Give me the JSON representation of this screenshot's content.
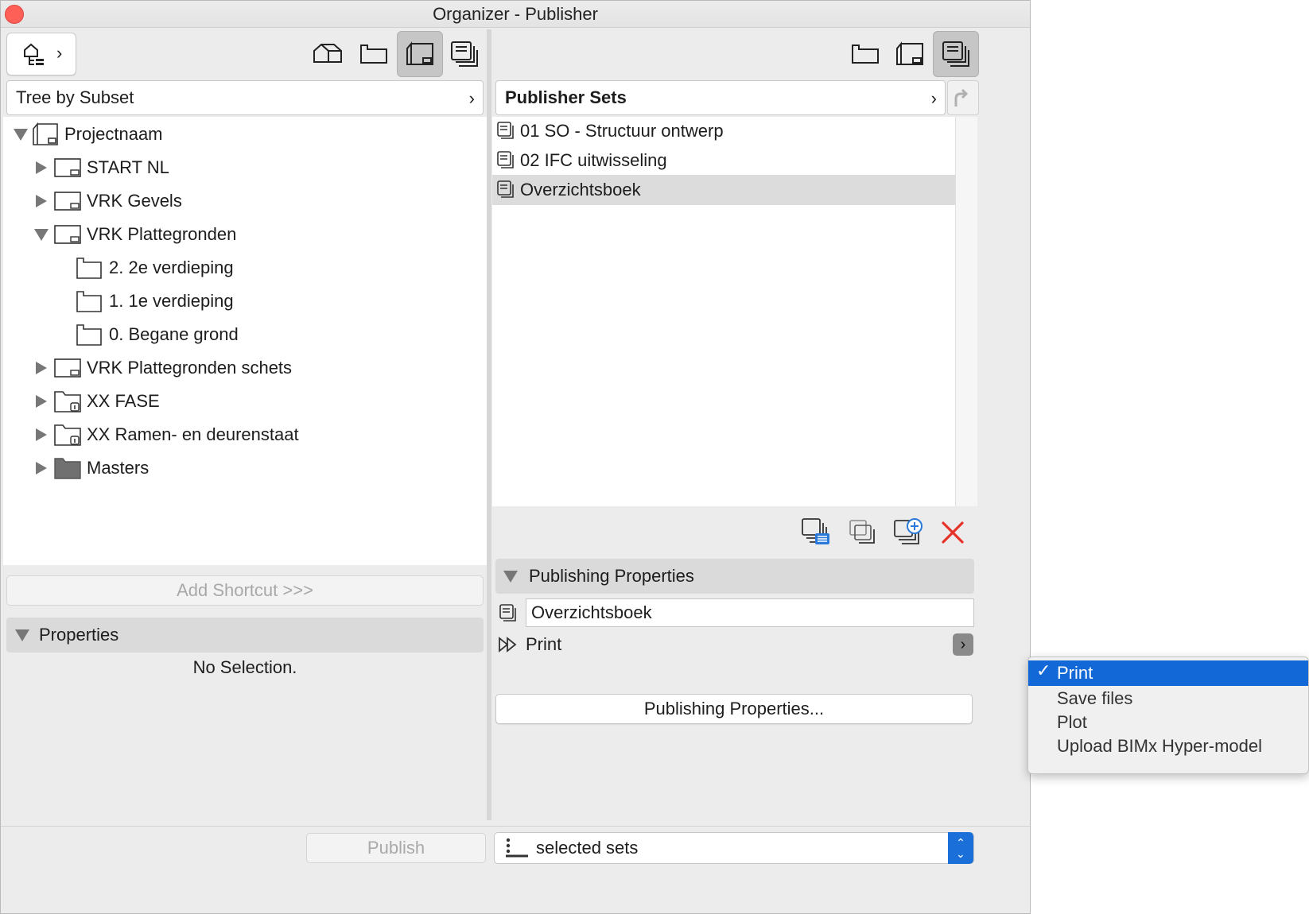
{
  "window": {
    "title": "Organizer - Publisher"
  },
  "left": {
    "view_selector": "Tree by Subset",
    "tree": [
      {
        "label": "Projectnaam",
        "level": 0,
        "state": "expanded",
        "icon": "project-icon"
      },
      {
        "label": "START NL",
        "level": 1,
        "state": "collapsed",
        "icon": "layout-icon"
      },
      {
        "label": "VRK Gevels",
        "level": 1,
        "state": "collapsed",
        "icon": "layout-icon"
      },
      {
        "label": "VRK Plattegronden",
        "level": 1,
        "state": "expanded",
        "icon": "layout-icon"
      },
      {
        "label": "2. 2e verdieping",
        "level": 2,
        "state": "leaf",
        "icon": "view-icon"
      },
      {
        "label": "1. 1e verdieping",
        "level": 2,
        "state": "leaf",
        "icon": "view-icon"
      },
      {
        "label": "0. Begane grond",
        "level": 2,
        "state": "leaf",
        "icon": "view-icon"
      },
      {
        "label": "VRK Plattegronden schets",
        "level": 1,
        "state": "collapsed",
        "icon": "layout-icon"
      },
      {
        "label": "XX FASE",
        "level": 1,
        "state": "collapsed",
        "icon": "subset-folder-icon"
      },
      {
        "label": "XX Ramen- en deurenstaat",
        "level": 1,
        "state": "collapsed",
        "icon": "subset-folder-icon"
      },
      {
        "label": "Masters",
        "level": 1,
        "state": "collapsed",
        "icon": "masters-folder-icon"
      }
    ],
    "add_shortcut": "Add Shortcut >>>",
    "properties_header": "Properties",
    "no_selection": "No Selection."
  },
  "right": {
    "set_selector": "Publisher Sets",
    "sets": [
      "01 SO - Structuur ontwerp",
      "02 IFC uitwisseling",
      "Overzichtsboek"
    ],
    "selected_set_index": 2,
    "publishing_header": "Publishing Properties",
    "set_name_value": "Overzichtsboek",
    "method_label": "Print",
    "publishing_button": "Publishing Properties..."
  },
  "dropdown": {
    "items": [
      "Print",
      "Save files",
      "Plot",
      "Upload BIMx Hyper-model"
    ],
    "selected_index": 0
  },
  "footer": {
    "publish_button": "Publish",
    "scope_value": "selected sets"
  },
  "colors": {
    "accent": "#1268d6",
    "delete": "#e5332a",
    "selection": "#dcdcdc"
  }
}
